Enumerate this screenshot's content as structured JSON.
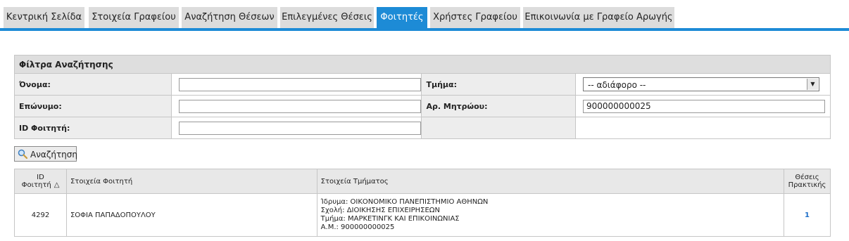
{
  "tabs": [
    {
      "label": "Κεντρική Σελίδα",
      "active": false
    },
    {
      "label": "Στοιχεία Γραφείου",
      "active": false
    },
    {
      "label": "Αναζήτηση Θέσεων",
      "active": false
    },
    {
      "label": "Επιλεγμένες Θέσεις",
      "active": false
    },
    {
      "label": "Φοιτητές",
      "active": true
    },
    {
      "label": "Χρήστες Γραφείου",
      "active": false
    },
    {
      "label": "Επικοινωνία με Γραφείο Αρωγής",
      "active": false
    }
  ],
  "filters": {
    "title": "Φίλτρα Αναζήτησης",
    "first_name_label": "Όνομα:",
    "first_name_value": "",
    "department_label": "Τμήμα:",
    "department_value": "-- αδιάφορο --",
    "last_name_label": "Επώνυμο:",
    "last_name_value": "",
    "registry_label": "Αρ. Μητρώου:",
    "registry_value": "900000000025",
    "student_id_label": "ID Φοιτητή:",
    "student_id_value": ""
  },
  "search_button": {
    "label": "Αναζήτηση",
    "icon": "magnifier-icon"
  },
  "results": {
    "headers": {
      "id_line1": "ID",
      "id_line2": "Φοιτητή",
      "sort_indicator": "△",
      "student": "Στοιχεία Φοιτητή",
      "department": "Στοιχεία Τμήματος",
      "positions_line1": "Θέσεις",
      "positions_line2": "Πρακτικής"
    },
    "rows": [
      {
        "id": "4292",
        "student_name": "ΣΟΦΙΑ ΠΑΠΑΔΟΠΟΥΛΟΥ",
        "institution": "Ίδρυμα: ΟΙΚΟΝΟΜΙΚΟ ΠΑΝΕΠΙΣΤΗΜΙΟ ΑΘΗΝΩΝ",
        "school": "Σχολή: ΔΙΟΙΚΗΣΗΣ ΕΠΙΧΕΙΡΗΣΕΩΝ",
        "department": "Τμήμα: ΜΑΡΚΕΤΙΝΓΚ ΚΑΙ ΕΠΙΚΟΙΝΩΝΙΑΣ",
        "registry": "Α.Μ.: 900000000025",
        "positions": "1"
      }
    ]
  },
  "colors": {
    "accent": "#1d8bd6",
    "tab_bg": "#dcdcdc",
    "link": "#1d6fc8"
  }
}
